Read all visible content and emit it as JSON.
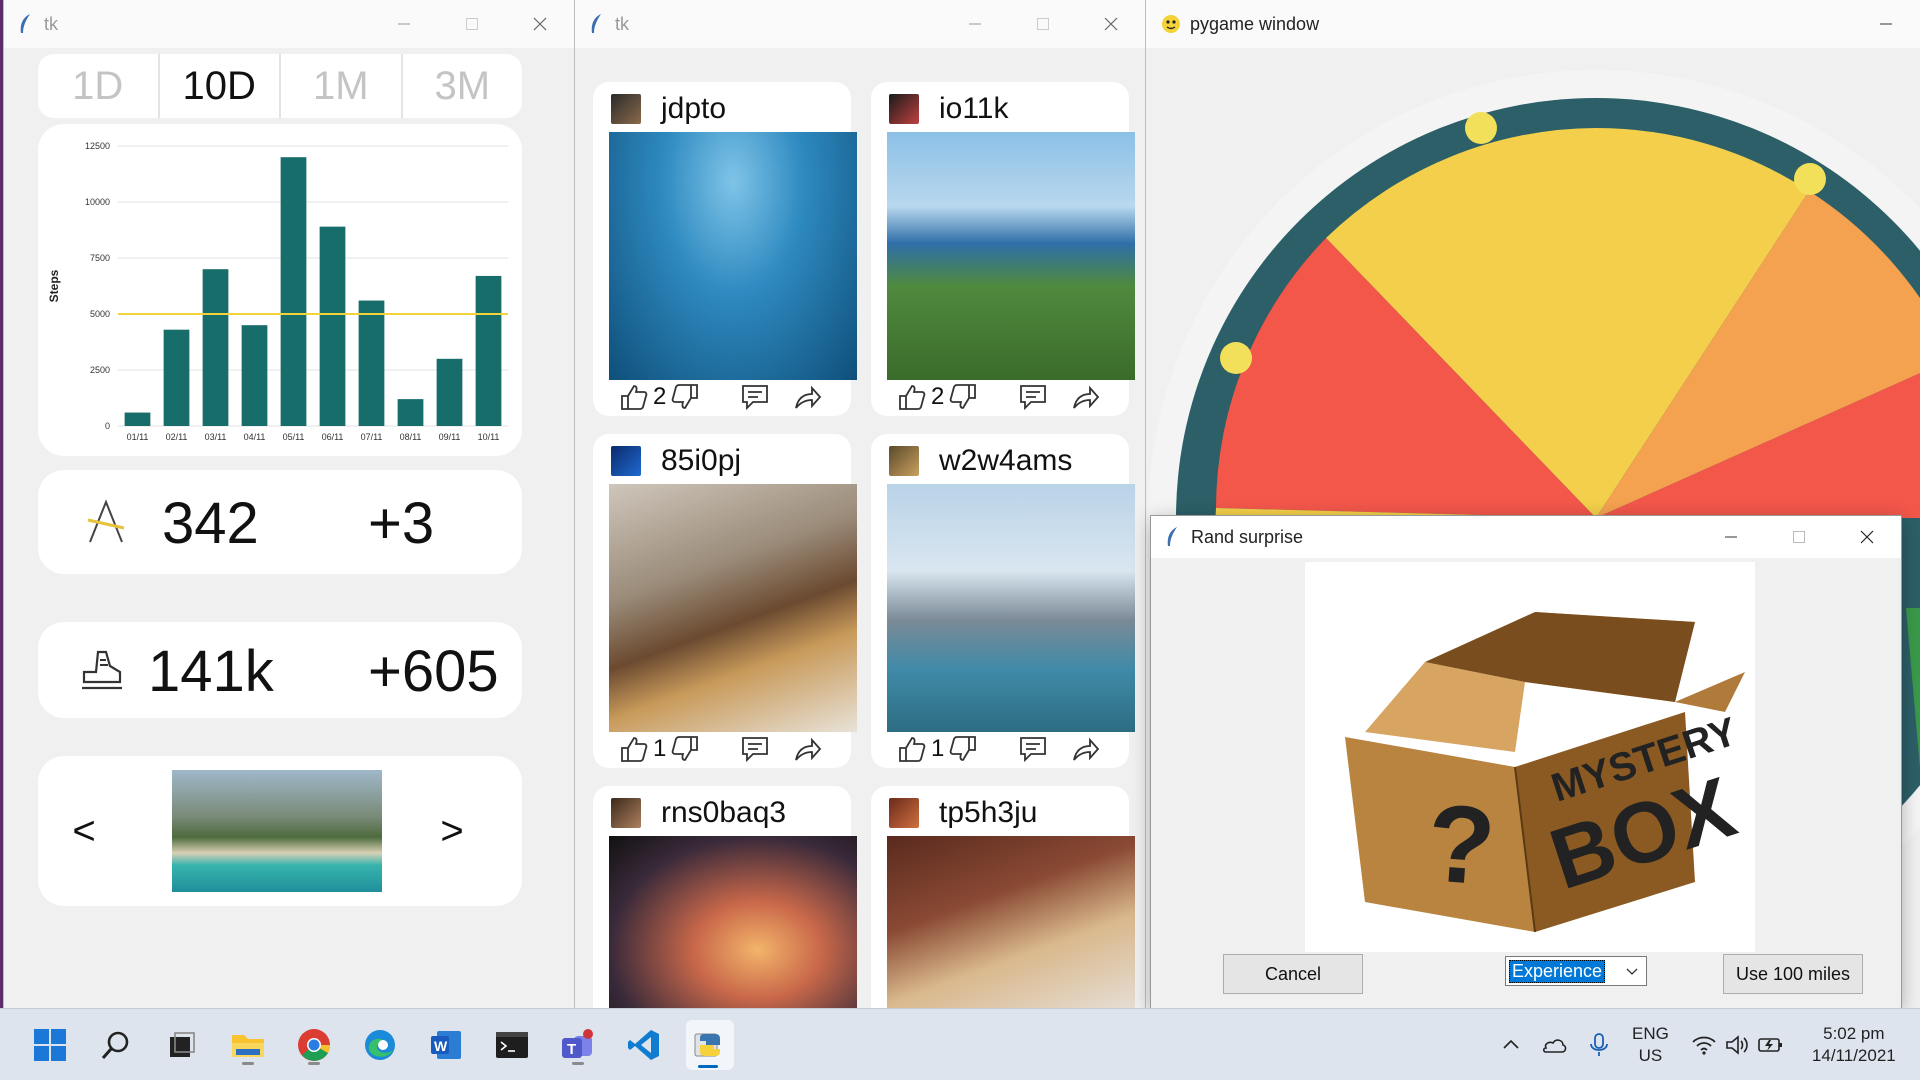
{
  "windows": {
    "steps": {
      "title": "tk",
      "range_tabs": [
        "1D",
        "10D",
        "1M",
        "3M"
      ],
      "active_tab": "10D",
      "elevation": {
        "value": "342",
        "delta": "+3",
        "icon": "elevation-icon"
      },
      "steps": {
        "value": "141k",
        "delta": "+605",
        "icon": "shoe-icon"
      },
      "carousel": {
        "prev": "<",
        "next": ">"
      }
    },
    "feed": {
      "title": "tk",
      "posts": [
        {
          "user": "jdpto",
          "likes": "2"
        },
        {
          "user": "io11k",
          "likes": "2"
        },
        {
          "user": "85i0pj",
          "likes": "1"
        },
        {
          "user": "w2w4ams",
          "likes": "1"
        },
        {
          "user": "rns0baq3",
          "likes": ""
        },
        {
          "user": "tp5h3ju",
          "likes": ""
        }
      ]
    },
    "pygame": {
      "title": "pygame window"
    },
    "rand": {
      "title": "Rand surprise",
      "box_text_1": "MYSTERY",
      "box_text_2": "BOX",
      "box_q": "?",
      "cancel_label": "Cancel",
      "select_value": "Experience",
      "use_label": "Use 100 miles"
    }
  },
  "taskbar": {
    "lang_1": "ENG",
    "lang_2": "US",
    "time": "5:02 pm",
    "date": "14/11/2021"
  },
  "colors": {
    "bar": "#176d6a",
    "goal_line": "#f2d43a",
    "wheel_red": "#f2574a",
    "wheel_yellow": "#f3cf4b",
    "wheel_orange": "#f4a150",
    "wheel_ring": "#2c5f67"
  },
  "chart_data": {
    "type": "bar",
    "categories": [
      "01/11",
      "02/11",
      "03/11",
      "04/11",
      "05/11",
      "06/11",
      "07/11",
      "08/11",
      "09/11",
      "10/11"
    ],
    "values": [
      600,
      4300,
      7000,
      4500,
      12000,
      8900,
      5600,
      1200,
      3000,
      6700
    ],
    "ylabel": "Steps",
    "yticks": [
      0,
      2500,
      5000,
      7500,
      10000,
      12500
    ],
    "ylim": [
      0,
      12500
    ],
    "goal_line": 5000,
    "grid": true
  }
}
